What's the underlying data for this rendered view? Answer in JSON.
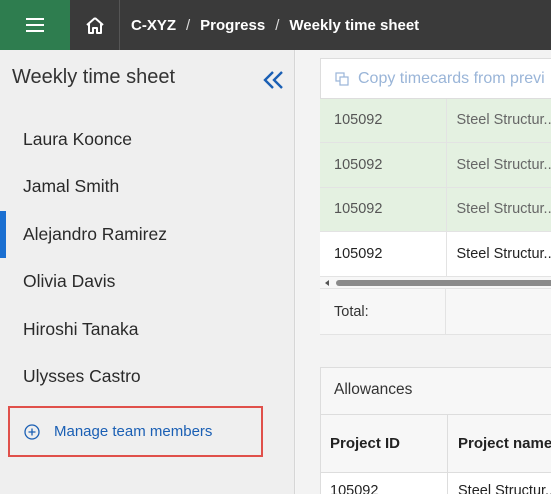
{
  "breadcrumb": [
    "C-XYZ",
    "Progress",
    "Weekly time sheet"
  ],
  "breadcrumb_separator": "/",
  "sidebar": {
    "title": "Weekly time sheet",
    "members": [
      {
        "name": "Laura Koonce"
      },
      {
        "name": "Jamal Smith"
      },
      {
        "name": "Alejandro Ramirez",
        "active": true
      },
      {
        "name": "Olivia Davis"
      },
      {
        "name": "Hiroshi Tanaka"
      },
      {
        "name": "Ulysses Castro"
      }
    ],
    "manage_label": "Manage team members"
  },
  "main": {
    "copy_label": "Copy timecards from previ",
    "rows": [
      {
        "project_id": "105092",
        "project_name": "Steel Structur...",
        "highlighted": true
      },
      {
        "project_id": "105092",
        "project_name": "Steel Structur...",
        "highlighted": true
      },
      {
        "project_id": "105092",
        "project_name": "Steel Structur...",
        "highlighted": true
      },
      {
        "project_id": "105092",
        "project_name": "Steel Structur...",
        "highlighted": false
      }
    ],
    "total_label": "Total:",
    "allowances": {
      "title": "Allowances",
      "headers": [
        "Project ID",
        "Project name"
      ],
      "row": [
        "105092",
        "Steel Structur..."
      ]
    }
  },
  "colors": {
    "menu_button": "#2e7d4f",
    "topbar": "#3a3a3a",
    "active_indicator": "#1a6fd1",
    "highlight_row": "#e4f1e1",
    "callout_border": "#e0504a"
  }
}
